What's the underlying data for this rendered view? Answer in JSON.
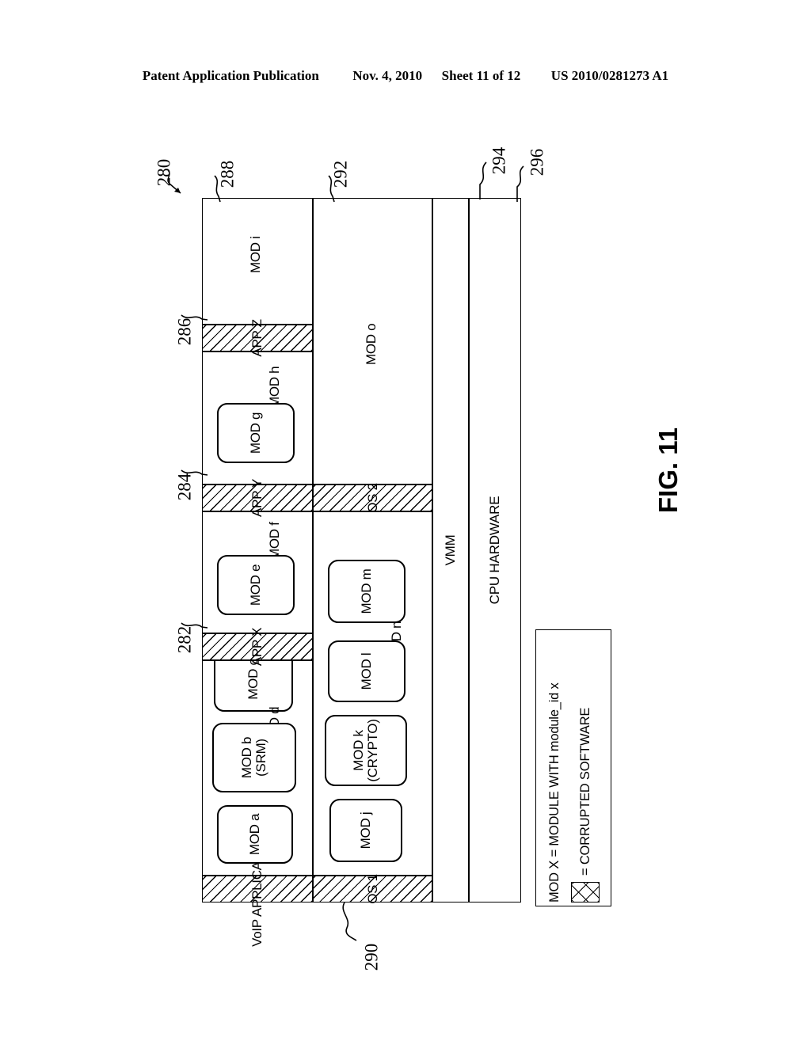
{
  "header": {
    "publication": "Patent Application Publication",
    "date": "Nov. 4, 2010",
    "sheet": "Sheet 11 of 12",
    "number": "US 2010/0281273 A1"
  },
  "figure": {
    "label": "FIG. 11",
    "reference_numerals": [
      {
        "id": "280",
        "target": "overall-system"
      },
      {
        "id": "282",
        "target": "voip-application"
      },
      {
        "id": "284",
        "target": "app-x"
      },
      {
        "id": "286",
        "target": "app-y"
      },
      {
        "id": "288",
        "target": "app-z"
      },
      {
        "id": "290",
        "target": "os-1"
      },
      {
        "id": "292",
        "target": "os-2"
      },
      {
        "id": "294",
        "target": "vmm"
      },
      {
        "id": "296",
        "target": "cpu-hardware"
      }
    ]
  },
  "applications": [
    {
      "name": "VoIP APPLICATION",
      "ref": "282",
      "region_label": "MOD d",
      "modules": [
        {
          "label": "MOD a",
          "corrupted": false
        },
        {
          "label": "MOD b\n(SRM)",
          "corrupted": false
        },
        {
          "label": "MOD c",
          "corrupted": true
        }
      ]
    },
    {
      "name": "APP X",
      "ref": "284",
      "region_label": "MOD f",
      "modules": [
        {
          "label": "MOD e",
          "corrupted": false
        }
      ]
    },
    {
      "name": "APP Y",
      "ref": "286",
      "region_label": "MOD h",
      "modules": [
        {
          "label": "MOD g",
          "corrupted": false
        }
      ]
    },
    {
      "name": "APP Z",
      "ref": "288",
      "region_label": "MOD i",
      "modules": []
    }
  ],
  "operating_systems": [
    {
      "name": "OS 1",
      "ref": "290",
      "region_label": "MOD n",
      "modules": [
        {
          "label": "MOD j",
          "corrupted": true
        },
        {
          "label": "MOD k\n(CRYPTO)",
          "corrupted": false
        },
        {
          "label": "MOD l",
          "corrupted": false
        },
        {
          "label": "MOD m",
          "corrupted": false
        }
      ]
    },
    {
      "name": "OS 2",
      "ref": "292",
      "region_label": "MOD o",
      "modules": []
    }
  ],
  "platform_layers": [
    {
      "label": "VMM",
      "ref": "294"
    },
    {
      "label": "CPU HARDWARE",
      "ref": "296"
    }
  ],
  "legend": {
    "line_1": "MOD X = MODULE WITH module_id x",
    "line_2": "= CORRUPTED SOFTWARE",
    "swatch_pattern": "cross-hatch"
  }
}
